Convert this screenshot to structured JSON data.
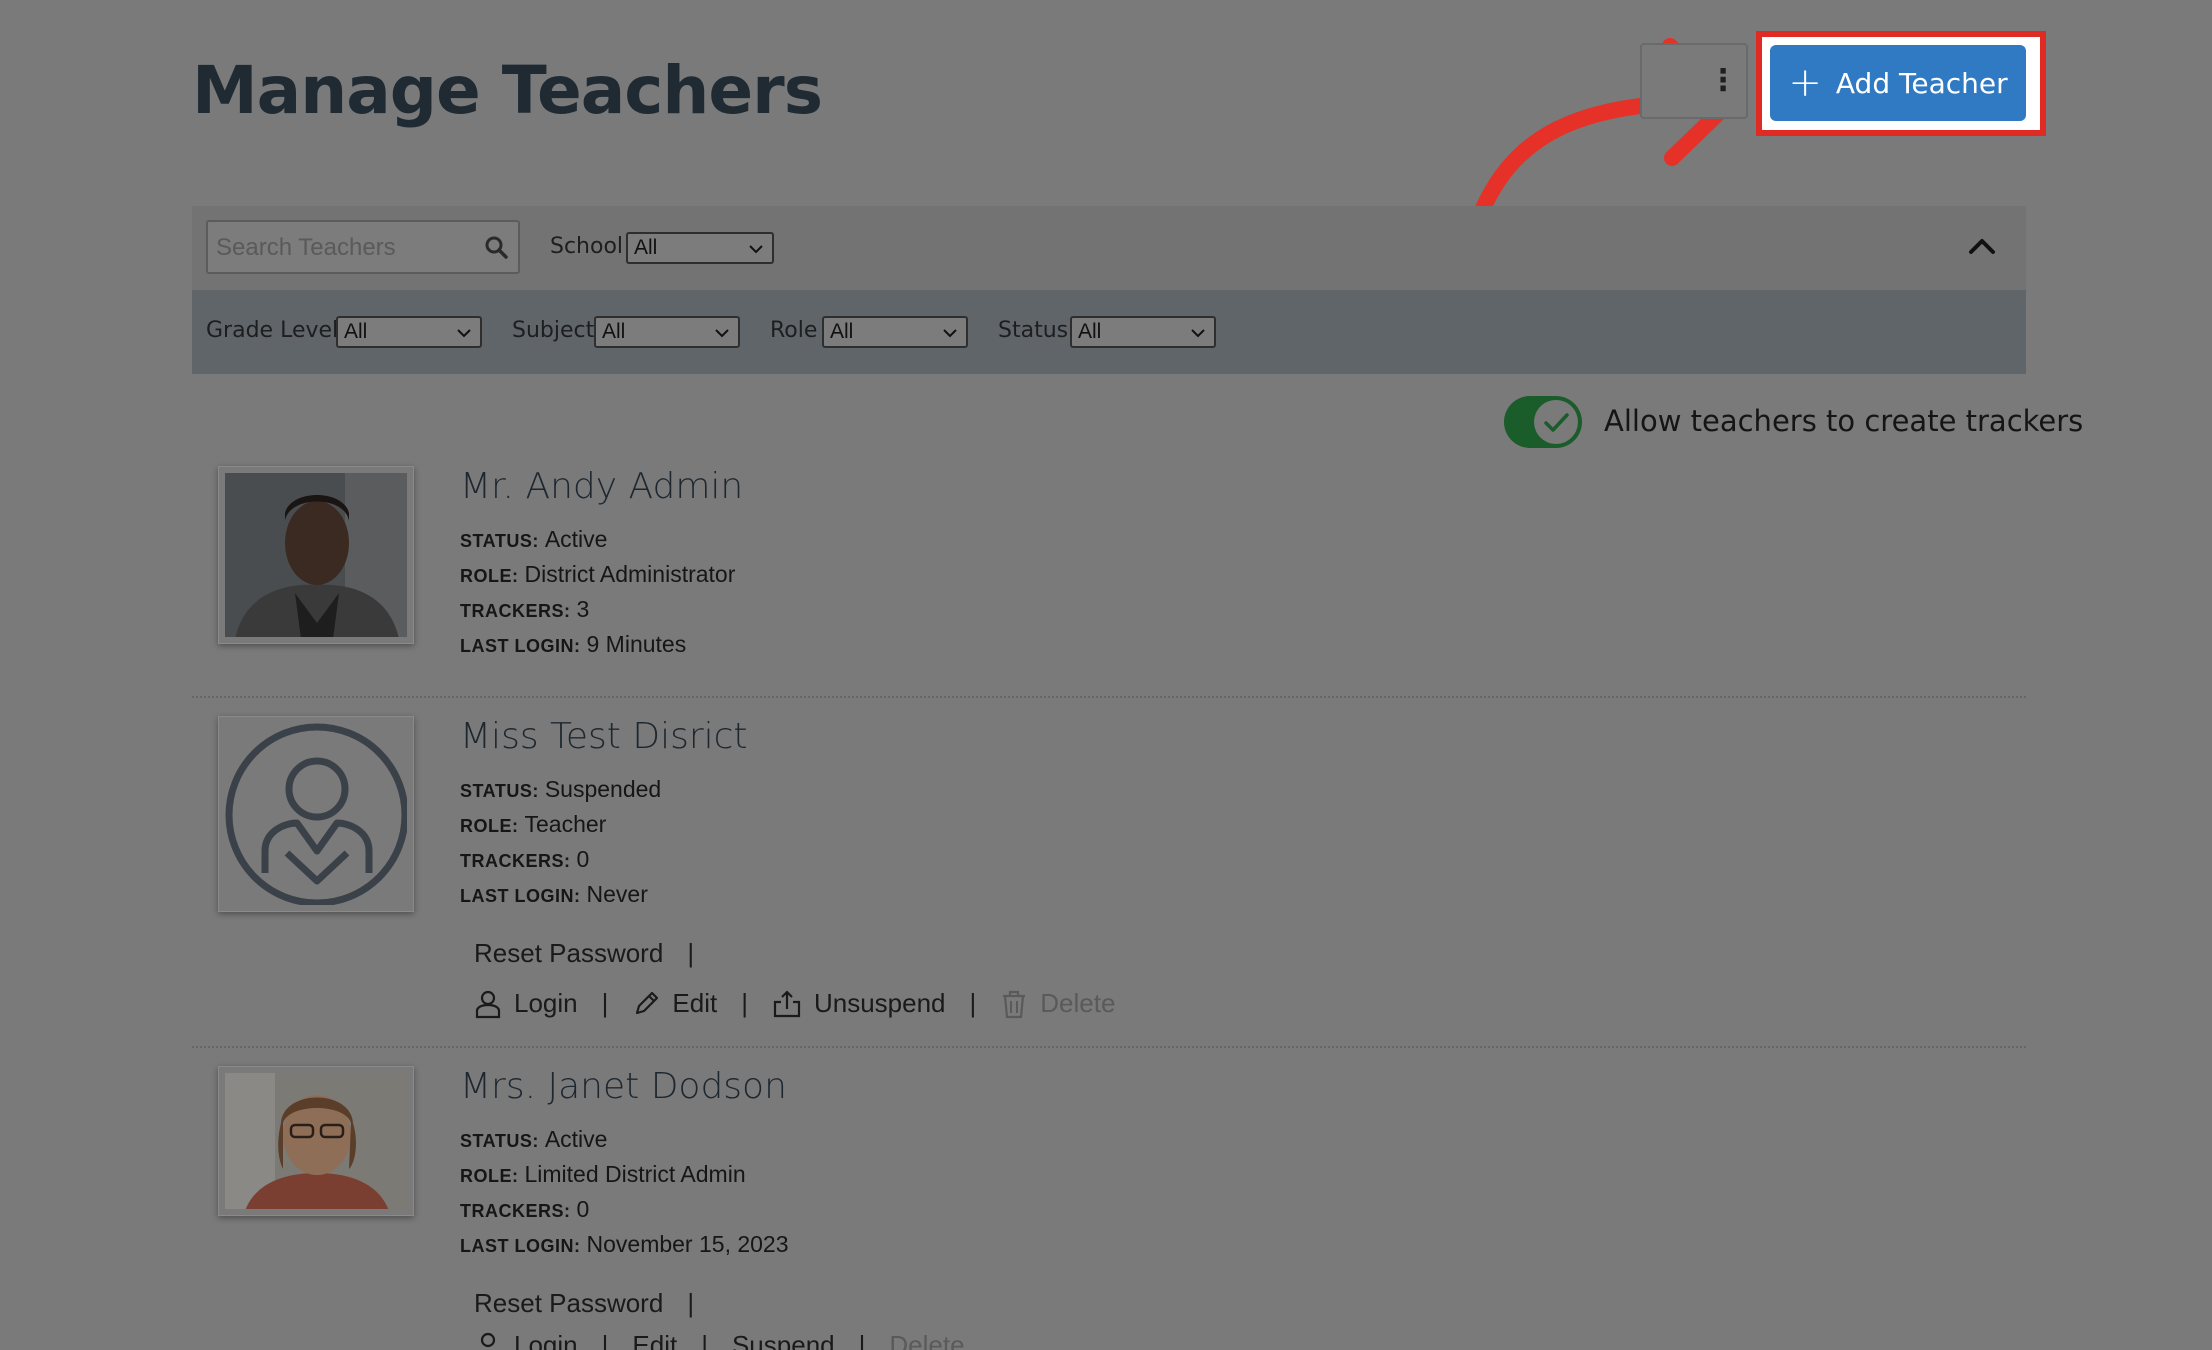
{
  "page": {
    "title": "Manage Teachers"
  },
  "toolbar": {
    "more_label": "⋮",
    "add_teacher_label": "Add Teacher"
  },
  "filters": {
    "search_placeholder": "Search Teachers",
    "school_label": "School",
    "school_value": "All",
    "grade_label": "Grade Level",
    "grade_value": "All",
    "subject_label": "Subject",
    "subject_value": "All",
    "role_label": "Role",
    "role_value": "All",
    "status_label": "Status",
    "status_value": "All"
  },
  "toggle": {
    "label": "Allow teachers to create trackers",
    "on": true
  },
  "labels": {
    "status": "STATUS:",
    "role": "ROLE:",
    "trackers": "TRACKERS:",
    "last_login": "LAST LOGIN:",
    "reset_password": "Reset Password",
    "login": "Login",
    "edit": "Edit",
    "unsuspend": "Unsuspend",
    "suspend": "Suspend",
    "delete": "Delete",
    "separator": "|"
  },
  "teachers": [
    {
      "name": "Mr. Andy Admin",
      "status": "Active",
      "role": "District Administrator",
      "trackers": "3",
      "last_login": "9 Minutes"
    },
    {
      "name": "Miss Test Disrict",
      "status": "Suspended",
      "role": "Teacher",
      "trackers": "0",
      "last_login": "Never"
    },
    {
      "name": "Mrs. Janet Dodson",
      "status": "Active",
      "role": "Limited District Admin",
      "trackers": "0",
      "last_login": "November 15, 2023"
    }
  ],
  "colors": {
    "accent": "#2f7ac3",
    "highlight": "#e02a24",
    "toggle_on": "#1b5c2b",
    "overlay": "#7a7a7a"
  }
}
